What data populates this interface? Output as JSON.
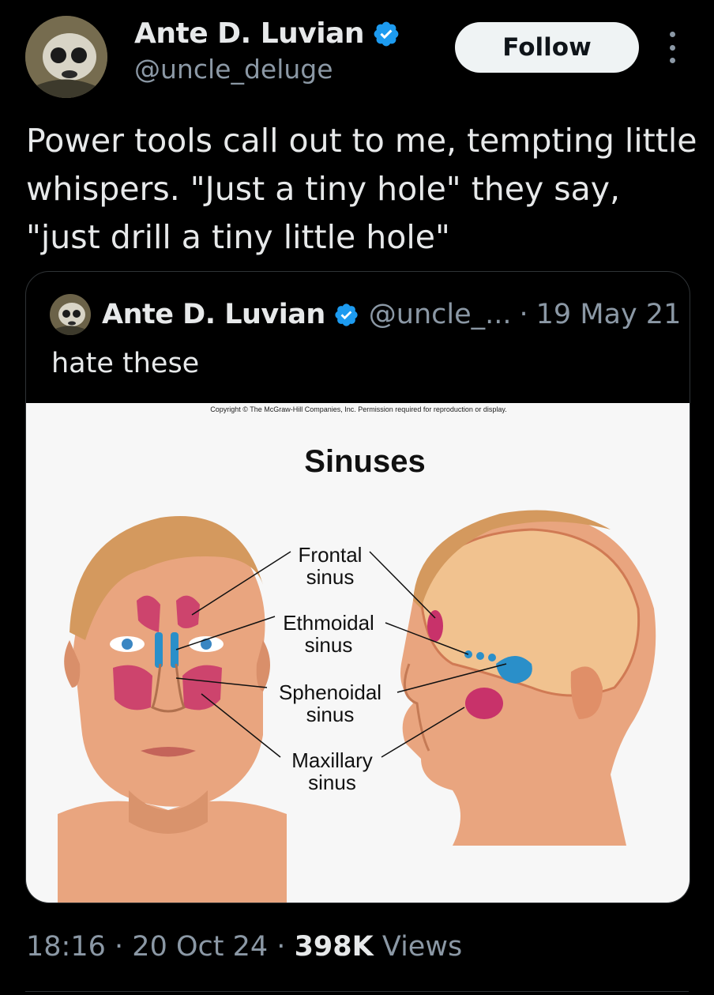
{
  "tweet": {
    "author_name": "Ante D. Luvian",
    "author_handle": "@uncle_deluge",
    "follow_label": "Follow",
    "text": "Power tools call out to me, tempting little whispers. \"Just a tiny hole\" they say, \"just drill a tiny little hole\"",
    "time": "18:16",
    "date": "20 Oct 24",
    "views_count": "398K",
    "views_label": "Views",
    "separator": "·"
  },
  "quoted": {
    "author_name": "Ante D. Luvian",
    "author_handle": "@uncle_...",
    "separator": "·",
    "date": "19 May 21",
    "text": "hate these"
  },
  "figure": {
    "copyright": "Copyright © The McGraw-Hill Companies, Inc. Permission required for reproduction or display.",
    "title": "Sinuses",
    "labels": {
      "frontal_1": "Frontal",
      "frontal_2": "sinus",
      "ethmoidal_1": "Ethmoidal",
      "ethmoidal_2": "sinus",
      "sphenoidal_1": "Sphenoidal",
      "sphenoidal_2": "sinus",
      "maxillary_1": "Maxillary",
      "maxillary_2": "sinus"
    }
  },
  "colors": {
    "background": "#000000",
    "text": "#e7e9ea",
    "secondary": "#8b98a5",
    "verified": "#1d9bf0",
    "follow_bg": "#eff3f4",
    "sinus_pink": "#c8326a",
    "sinus_blue": "#2a8fc9",
    "skin": "#e8a07a"
  },
  "icons": {
    "verified": "verified-badge-icon",
    "more": "more-vertical-icon"
  }
}
